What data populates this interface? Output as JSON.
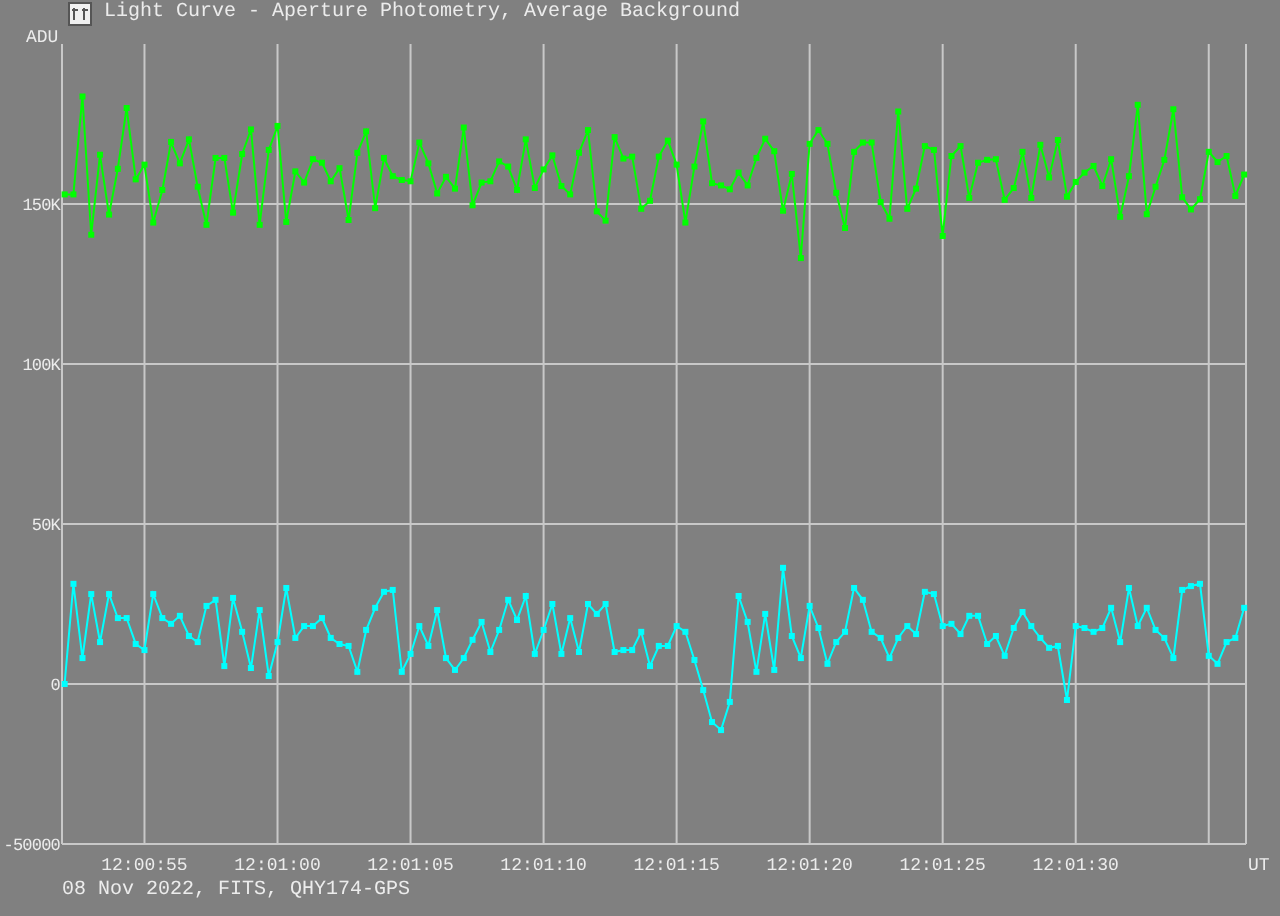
{
  "window": {
    "title": "Light Curve - Aperture Photometry, Average Background"
  },
  "chart_data": {
    "type": "line",
    "xlabel": "UT",
    "ylabel": "ADU",
    "xlim": [
      43251.9,
      43296.4
    ],
    "ylim": [
      -50000,
      200000
    ],
    "xticks": [
      {
        "value": 43255,
        "label": "12:00:55"
      },
      {
        "value": 43260,
        "label": "12:01:00"
      },
      {
        "value": 43265,
        "label": "12:01:05"
      },
      {
        "value": 43270,
        "label": "12:01:10"
      },
      {
        "value": 43275,
        "label": "12:01:15"
      },
      {
        "value": 43280,
        "label": "12:01:20"
      },
      {
        "value": 43285,
        "label": "12:01:25"
      },
      {
        "value": 43290,
        "label": "12:01:30"
      }
    ],
    "yticks": [
      {
        "value": -50000,
        "label": "-50000"
      },
      {
        "value": 0,
        "label": "0"
      },
      {
        "value": 50000,
        "label": "50K"
      },
      {
        "value": 100000,
        "label": "100K"
      },
      {
        "value": 150000,
        "label": "150K"
      }
    ],
    "grid": true,
    "x": [
      43252,
      43252.33,
      43252.67,
      43253,
      43253.33,
      43253.67,
      43254,
      43254.33,
      43254.67,
      43255,
      43255.33,
      43255.67,
      43256,
      43256.33,
      43256.67,
      43257,
      43257.33,
      43257.67,
      43258,
      43258.33,
      43258.67,
      43259,
      43259.33,
      43259.67,
      43260,
      43260.33,
      43260.67,
      43261,
      43261.33,
      43261.67,
      43262,
      43262.33,
      43262.67,
      43263,
      43263.33,
      43263.67,
      43264,
      43264.33,
      43264.67,
      43265,
      43265.33,
      43265.67,
      43266,
      43266.33,
      43266.67,
      43267,
      43267.33,
      43267.67,
      43268,
      43268.33,
      43268.67,
      43269,
      43269.33,
      43269.67,
      43270,
      43270.33,
      43270.67,
      43271,
      43271.33,
      43271.67,
      43272,
      43272.33,
      43272.67,
      43273,
      43273.33,
      43273.67,
      43274,
      43274.33,
      43274.67,
      43275,
      43275.33,
      43275.67,
      43276,
      43276.33,
      43276.67,
      43277,
      43277.33,
      43277.67,
      43278,
      43278.33,
      43278.67,
      43279,
      43279.33,
      43279.67,
      43280,
      43280.33,
      43280.67,
      43281,
      43281.33,
      43281.67,
      43282,
      43282.33,
      43282.67,
      43283,
      43283.33,
      43283.67,
      43284,
      43284.33,
      43284.67,
      43285,
      43285.33,
      43285.67,
      43286,
      43286.33,
      43286.67,
      43287,
      43287.33,
      43287.67,
      43288,
      43288.33,
      43288.67,
      43289,
      43289.33,
      43289.67,
      43290,
      43290.33,
      43290.67,
      43291,
      43291.33,
      43291.67,
      43292,
      43292.33,
      43292.67,
      43293,
      43293.33,
      43293.67,
      43294,
      43294.33,
      43294.67,
      43295,
      43295.33,
      43295.67,
      43296,
      43296.33
    ],
    "series": [
      {
        "color": "#00ff00",
        "marker": "square",
        "values": [
          153000,
          153000,
          183600,
          140400,
          165400,
          146700,
          161000,
          180000,
          157700,
          162300,
          144200,
          154400,
          169400,
          162700,
          170200,
          155400,
          143500,
          164400,
          164400,
          147300,
          165600,
          173300,
          143500,
          166900,
          174400,
          144400,
          160200,
          156700,
          164000,
          162900,
          157100,
          161200,
          145000,
          166000,
          172700,
          148700,
          164400,
          158700,
          157500,
          157100,
          169200,
          162700,
          153300,
          158500,
          154800,
          173900,
          149600,
          156700,
          157100,
          163300,
          161700,
          154400,
          170200,
          155000,
          160800,
          165200,
          155600,
          153000,
          166000,
          173100,
          147700,
          144800,
          170900,
          164200,
          164800,
          148500,
          151000,
          164800,
          169800,
          162300,
          144200,
          161700,
          175800,
          156500,
          155800,
          154600,
          159800,
          155800,
          164400,
          170400,
          166500,
          147900,
          159400,
          133100,
          168800,
          173100,
          168800,
          153500,
          142500,
          166300,
          169200,
          169200,
          150600,
          145400,
          178900,
          148500,
          154800,
          168100,
          166900,
          140000,
          165000,
          168100,
          151900,
          162900,
          163800,
          164000,
          151300,
          155000,
          166300,
          151900,
          168500,
          158300,
          170000,
          152300,
          156900,
          159800,
          161900,
          155600,
          164000,
          146000,
          158700,
          181000,
          146800,
          155400,
          163800,
          179600,
          152100,
          148300,
          151500,
          166300,
          163100,
          165000,
          152500,
          159200
        ]
      },
      {
        "color": "#00ffff",
        "marker": "square",
        "values": [
          0,
          31300,
          8100,
          28100,
          13100,
          28100,
          20600,
          20600,
          12500,
          10600,
          28100,
          20600,
          18800,
          21300,
          15000,
          13100,
          24400,
          26300,
          5600,
          26900,
          16300,
          5000,
          23100,
          2500,
          13100,
          30000,
          14400,
          18100,
          18100,
          20600,
          14400,
          12500,
          11900,
          3800,
          16900,
          23800,
          28800,
          29400,
          3800,
          9400,
          18100,
          11900,
          23100,
          8100,
          4400,
          8100,
          13800,
          19400,
          10000,
          16900,
          26300,
          20000,
          27500,
          9400,
          16900,
          25000,
          9400,
          20600,
          10000,
          25000,
          21900,
          25000,
          10000,
          10600,
          10600,
          16300,
          5600,
          11900,
          11900,
          18100,
          16300,
          7500,
          -1900,
          -11900,
          -14400,
          -5600,
          27500,
          19400,
          3800,
          21900,
          4400,
          36300,
          15000,
          8100,
          24400,
          17500,
          6300,
          13100,
          16300,
          30000,
          26300,
          16300,
          14400,
          8100,
          14400,
          18100,
          15600,
          28800,
          28100,
          18100,
          18800,
          15600,
          21300,
          21300,
          12500,
          15000,
          8800,
          17500,
          22500,
          18100,
          14400,
          11300,
          11900,
          -5000,
          18100,
          17500,
          16300,
          17500,
          23800,
          13100,
          30000,
          18100,
          23800,
          16900,
          14400,
          8100,
          29400,
          30600,
          31300,
          8800,
          6300,
          13100,
          14400,
          23800
        ]
      }
    ]
  },
  "status_bar": {
    "text": "08 Nov 2022, FITS, QHY174-GPS"
  }
}
